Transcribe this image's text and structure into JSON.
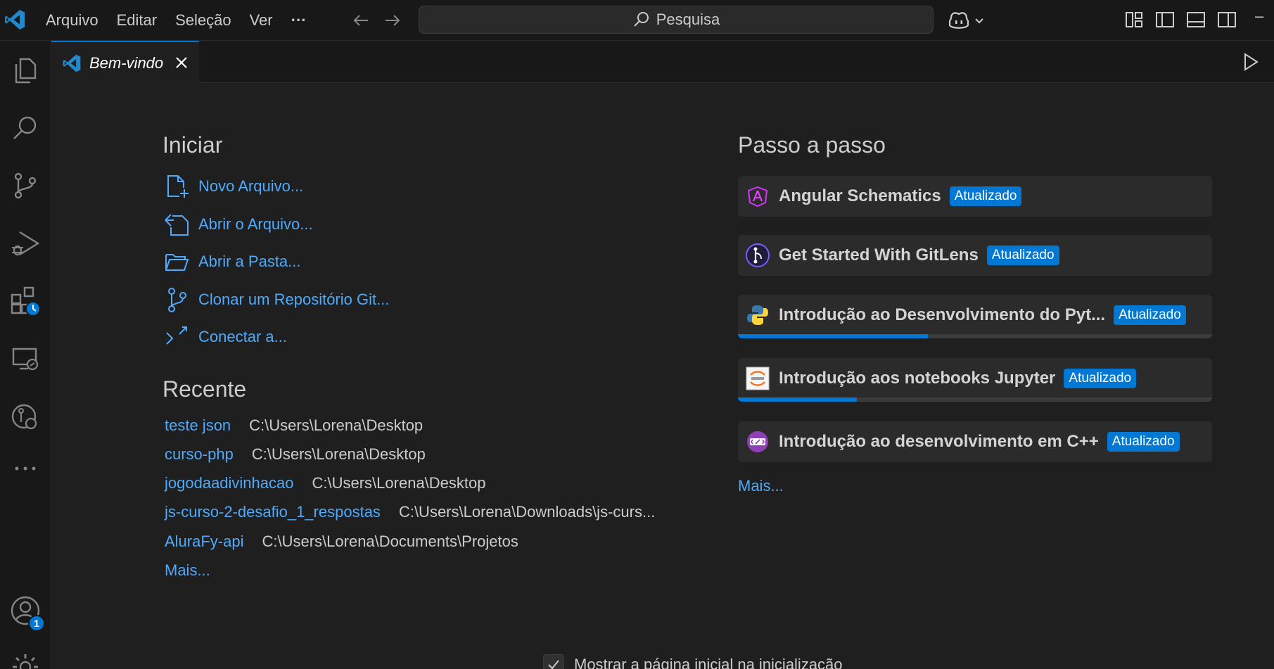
{
  "titlebar": {
    "menu": [
      "Arquivo",
      "Editar",
      "Seleção",
      "Ver",
      "···"
    ],
    "search_placeholder": "Pesquisa"
  },
  "activity": {
    "account_badge": "1"
  },
  "tab": {
    "label": "Bem-vindo"
  },
  "welcome": {
    "start_heading": "Iniciar",
    "start_items": [
      {
        "label": "Novo Arquivo...",
        "icon": "new-file-icon"
      },
      {
        "label": "Abrir o Arquivo...",
        "icon": "open-file-icon"
      },
      {
        "label": "Abrir a Pasta...",
        "icon": "folder-icon"
      },
      {
        "label": "Clonar um Repositório Git...",
        "icon": "git-branch-icon"
      },
      {
        "label": "Conectar a...",
        "icon": "remote-icon"
      }
    ],
    "recent_heading": "Recente",
    "recent": [
      {
        "name": "teste json",
        "path": "C:\\Users\\Lorena\\Desktop"
      },
      {
        "name": "curso-php",
        "path": "C:\\Users\\Lorena\\Desktop"
      },
      {
        "name": "jogodaadivinhacao",
        "path": "C:\\Users\\Lorena\\Desktop"
      },
      {
        "name": "js-curso-2-desafio_1_respostas",
        "path": "C:\\Users\\Lorena\\Downloads\\js-curs..."
      },
      {
        "name": "AluraFy-api",
        "path": "C:\\Users\\Lorena\\Documents\\Projetos"
      }
    ],
    "recent_more": "Mais...",
    "walk_heading": "Passo a passo",
    "walkthroughs": [
      {
        "title": "Angular Schematics",
        "badge": "Atualizado",
        "icon": "angular-icon",
        "progress": 0
      },
      {
        "title": "Get Started With GitLens",
        "badge": "Atualizado",
        "icon": "gitlens-icon",
        "progress": 0
      },
      {
        "title": "Introdução ao Desenvolvimento do Pyt...",
        "badge": "Atualizado",
        "icon": "python-icon",
        "progress": 0.4
      },
      {
        "title": "Introdução aos notebooks Jupyter",
        "badge": "Atualizado",
        "icon": "jupyter-icon",
        "progress": 0.25
      },
      {
        "title": "Introdução ao desenvolvimento em C++",
        "badge": "Atualizado",
        "icon": "cpp-icon",
        "progress": 0
      }
    ],
    "walk_more": "Mais...",
    "show_on_startup": "Mostrar a página inicial na inicialização"
  },
  "colors": {
    "accent": "#0078d4",
    "link": "#4daafc",
    "background": "#1f1f1f",
    "sidebar": "#181818"
  }
}
